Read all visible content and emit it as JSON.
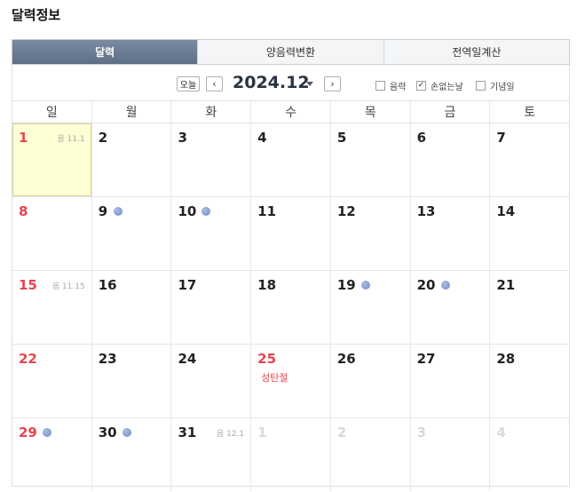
{
  "page_title": "달력정보",
  "tabs": [
    {
      "label": "달력",
      "active": true
    },
    {
      "label": "양음력변환",
      "active": false
    },
    {
      "label": "전역일계산",
      "active": false
    }
  ],
  "toolbar": {
    "today_label": "오늘",
    "prev_label": "‹",
    "next_label": "›",
    "month_label": "2024.12",
    "options": [
      {
        "label": "음력",
        "checked": false
      },
      {
        "label": "손없는날",
        "checked": true
      },
      {
        "label": "기념일",
        "checked": false
      }
    ]
  },
  "weekdays": [
    "일",
    "월",
    "화",
    "수",
    "목",
    "금",
    "토"
  ],
  "weeks": [
    [
      {
        "day": "1",
        "sun": true,
        "today": true,
        "lunar": "음 11.1"
      },
      {
        "day": "2"
      },
      {
        "day": "3"
      },
      {
        "day": "4"
      },
      {
        "day": "5"
      },
      {
        "day": "6"
      },
      {
        "day": "7"
      }
    ],
    [
      {
        "day": "8",
        "sun": true
      },
      {
        "day": "9",
        "dot": true
      },
      {
        "day": "10",
        "dot": true
      },
      {
        "day": "11"
      },
      {
        "day": "12"
      },
      {
        "day": "13"
      },
      {
        "day": "14"
      }
    ],
    [
      {
        "day": "15",
        "sun": true,
        "lunar": "음 11.15"
      },
      {
        "day": "16"
      },
      {
        "day": "17"
      },
      {
        "day": "18"
      },
      {
        "day": "19",
        "dot": true
      },
      {
        "day": "20",
        "dot": true
      },
      {
        "day": "21"
      }
    ],
    [
      {
        "day": "22",
        "sun": true
      },
      {
        "day": "23"
      },
      {
        "day": "24"
      },
      {
        "day": "25",
        "sun": true,
        "holiday": "성탄절"
      },
      {
        "day": "26"
      },
      {
        "day": "27"
      },
      {
        "day": "28"
      }
    ],
    [
      {
        "day": "29",
        "sun": true,
        "dot": true
      },
      {
        "day": "30",
        "dot": true
      },
      {
        "day": "31",
        "lunar": "음 12.1"
      },
      {
        "day": "1",
        "other": true
      },
      {
        "day": "2",
        "other": true
      },
      {
        "day": "3",
        "other": true
      },
      {
        "day": "4",
        "other": true
      }
    ]
  ],
  "colors": {
    "sunday": "#e8454e",
    "active_tab": "#5d6e86",
    "today_bg": "#ffffd6",
    "dot": "#7f98cc"
  }
}
